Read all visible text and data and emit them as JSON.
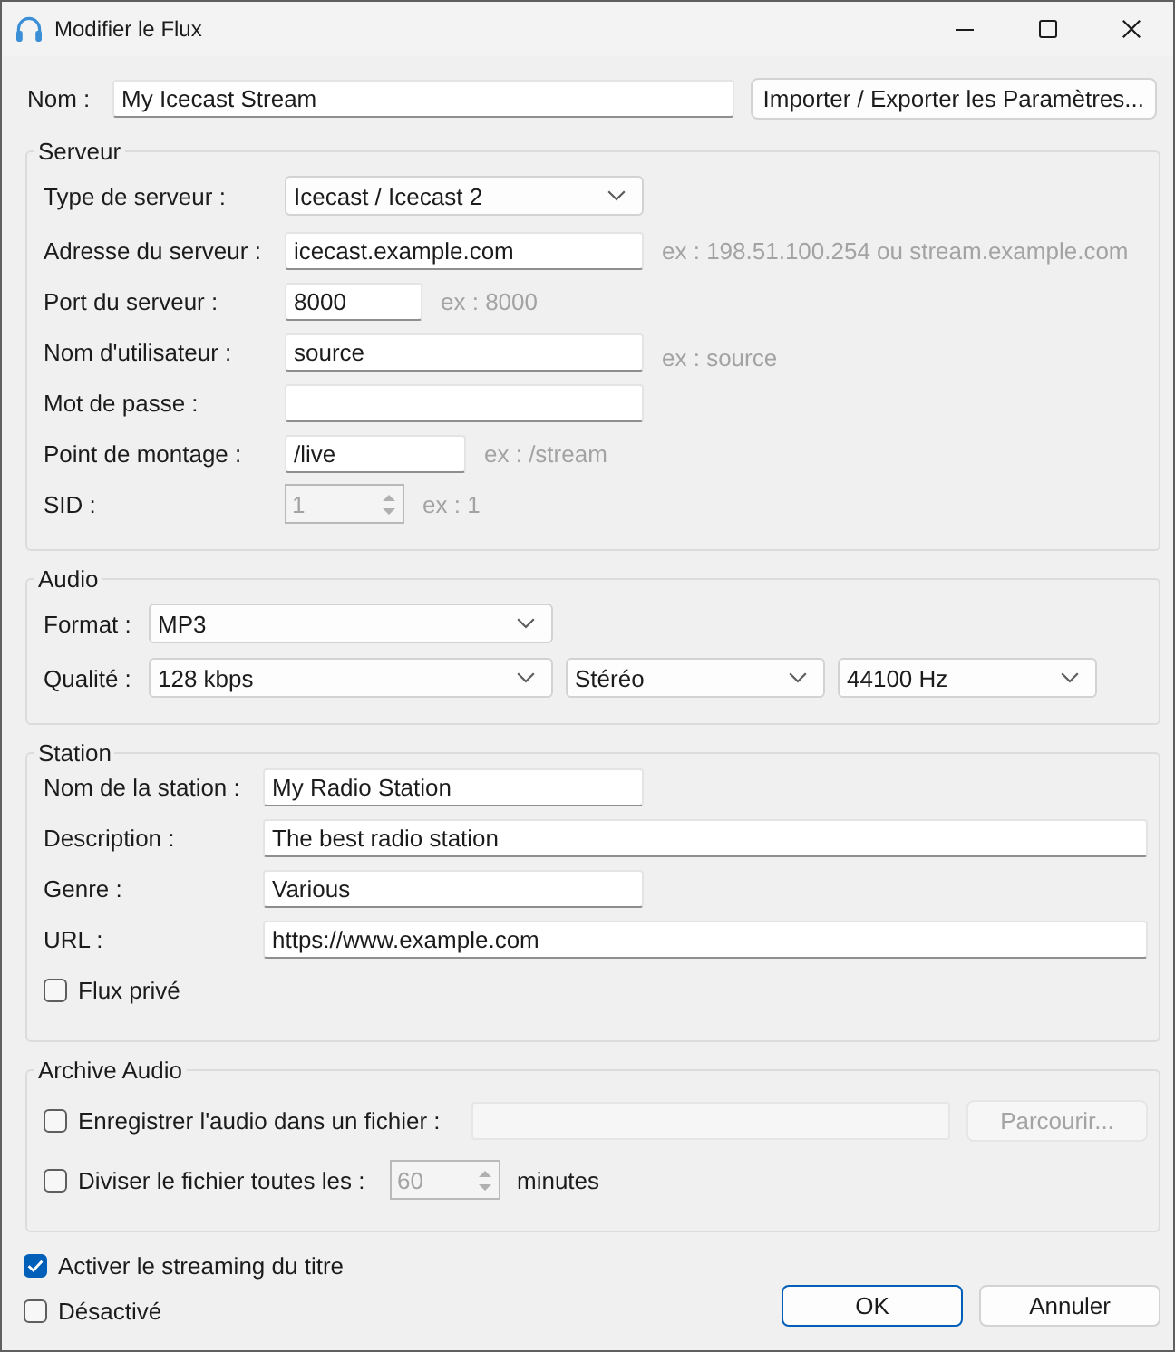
{
  "window": {
    "title": "Modifier le Flux"
  },
  "name": {
    "label": "Nom :",
    "value": "My Icecast Stream",
    "button": "Importer / Exporter les Paramètres..."
  },
  "server": {
    "title": "Serveur",
    "rows": [
      {
        "kind": "select",
        "label": "Type de serveur :",
        "value": "Icecast / Icecast 2"
      },
      {
        "kind": "text",
        "label": "Adresse du serveur :",
        "value": "icecast.example.com",
        "hint": "ex : 198.51.100.254 ou stream.example.com"
      },
      {
        "kind": "text",
        "label": "Port du serveur :",
        "value": "8000",
        "hint": "ex : 8000"
      },
      {
        "kind": "text",
        "label": "Nom d'utilisateur :",
        "value": "source",
        "hint": "ex : source"
      },
      {
        "kind": "text",
        "label": "Mot de passe :"
      },
      {
        "kind": "text",
        "label": "Point de montage :",
        "value": "/live",
        "hint": "ex : /stream"
      },
      {
        "kind": "spin",
        "label": "SID :",
        "value": "1",
        "disabled": true,
        "hint": "ex : 1"
      }
    ]
  },
  "audio": {
    "title": "Audio",
    "rows": [
      {
        "label": "Format :",
        "selects": [
          "MP3"
        ]
      },
      {
        "label": "Qualité :",
        "selects": [
          "128 kbps",
          "Stéréo",
          "44100 Hz"
        ]
      }
    ]
  },
  "station": {
    "title": "Station",
    "fields": [
      {
        "label": "Nom de la station :",
        "value": "My Radio Station"
      },
      {
        "label": "Description :",
        "value": "The best radio station"
      },
      {
        "label": "Genre :",
        "value": "Various"
      },
      {
        "label": "URL :",
        "value": "https://www.example.com"
      }
    ],
    "private": {
      "label": "Flux privé",
      "checked": false
    }
  },
  "archive": {
    "title": "Archive Audio",
    "record": {
      "label": "Enregistrer l'audio dans un fichier :",
      "checked": false,
      "path_field": {
        "disabled": true
      },
      "browse": {
        "label": "Parcourir...",
        "disabled": true
      }
    },
    "split": {
      "label": "Diviser le fichier toutes les :",
      "checked": false,
      "value": "60",
      "disabled": true,
      "unit": "minutes"
    }
  },
  "options": [
    {
      "label": "Activer le streaming du titre",
      "checked": true
    },
    {
      "label": "Désactivé",
      "checked": false
    }
  ],
  "buttons": [
    {
      "label": "OK",
      "default": true
    },
    {
      "label": "Annuler",
      "default": false
    }
  ]
}
